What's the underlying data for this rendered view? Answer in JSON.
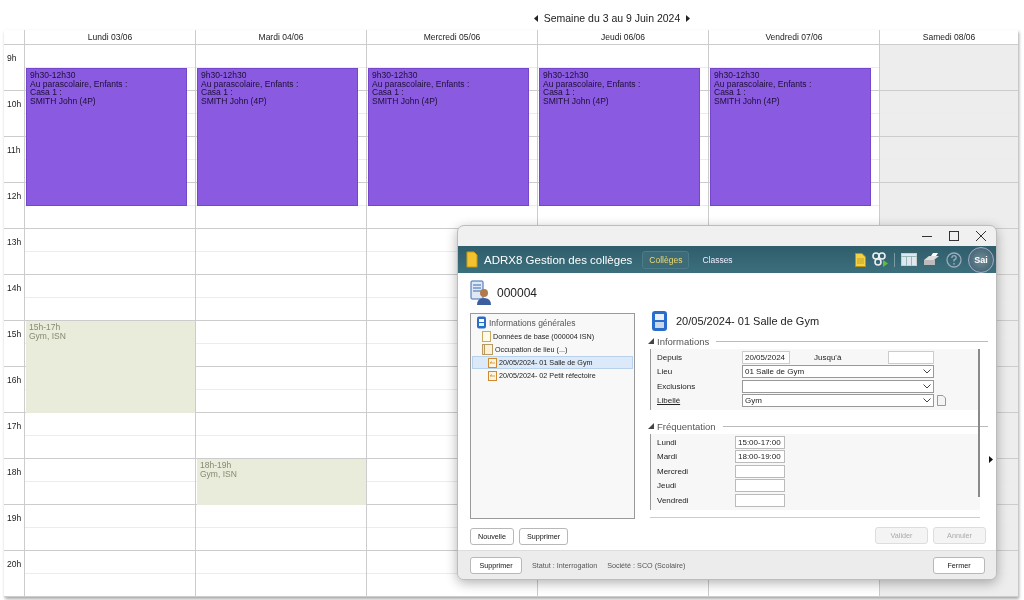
{
  "week_nav": {
    "title": "Semaine du 3 au 9 Juin 2024"
  },
  "calendar": {
    "hours": [
      "9h",
      "10h",
      "11h",
      "12h",
      "13h",
      "14h",
      "15h",
      "16h",
      "17h",
      "18h",
      "19h",
      "20h"
    ],
    "days": [
      {
        "label": "Lundi 03/06",
        "weekend": false,
        "events": [
          {
            "kind": "booking",
            "lines": [
              "9h30-12h30",
              "Au parascolaire, Enfants :",
              "Casa 1 :",
              "SMITH John (4P)"
            ]
          },
          {
            "kind": "occupation",
            "lines": [
              "15h-17h",
              "Gym, ISN"
            ]
          }
        ]
      },
      {
        "label": "Mardi 04/06",
        "weekend": false,
        "events": [
          {
            "kind": "booking",
            "lines": [
              "9h30-12h30",
              "Au parascolaire, Enfants :",
              "Casa 1 :",
              "SMITH John (4P)"
            ]
          },
          {
            "kind": "occupation",
            "lines": [
              "18h-19h",
              "Gym, ISN"
            ]
          }
        ]
      },
      {
        "label": "Mercredi 05/06",
        "weekend": false,
        "events": [
          {
            "kind": "booking",
            "lines": [
              "9h30-12h30",
              "Au parascolaire, Enfants :",
              "Casa 1 :",
              "SMITH John (4P)"
            ]
          }
        ]
      },
      {
        "label": "Jeudi 06/06",
        "weekend": false,
        "events": [
          {
            "kind": "booking",
            "lines": [
              "9h30-12h30",
              "Au parascolaire, Enfants :",
              "Casa 1 :",
              "SMITH John (4P)"
            ]
          }
        ]
      },
      {
        "label": "Vendredi 07/06",
        "weekend": false,
        "events": [
          {
            "kind": "booking",
            "lines": [
              "9h30-12h30",
              "Au parascolaire, Enfants :",
              "Casa 1 :",
              "SMITH John (4P)"
            ]
          }
        ]
      },
      {
        "label": "Samedi 08/06",
        "weekend": true
      }
    ]
  },
  "dialog": {
    "app_title": "ADRX8 Gestion des collèges",
    "tabs": [
      {
        "label": "Collèges",
        "selected": true
      },
      {
        "label": "Classes",
        "selected": false
      }
    ],
    "logo_text": "Sai",
    "record": "000004",
    "tree": [
      {
        "label": "Informations générales",
        "kind": "group",
        "selected": false,
        "children": [
          {
            "label": "Données de base (000004 ISN)",
            "kind": "document",
            "selected": false
          },
          {
            "label": "Occupation de lieu (...)",
            "kind": "folder",
            "selected": false,
            "children": [
              {
                "label": "20/05/2024- 01 Salle de Gym",
                "kind": "entry",
                "selected": true
              },
              {
                "label": "20/05/2024- 02 Petit réfectoire",
                "kind": "entry",
                "selected": false
              }
            ]
          }
        ]
      }
    ],
    "tree_buttons": [
      {
        "label": "Nouvelle",
        "disabled": false
      },
      {
        "label": "Supprimer",
        "disabled": false
      }
    ],
    "detail_title": "20/05/2024- 01 Salle de Gym",
    "informations": {
      "title": "Informations",
      "expanded": true,
      "fields": [
        {
          "kind": "date-range",
          "label": "Depuis",
          "value": "20/05/2024",
          "end_label": "Jusqu'à"
        },
        {
          "kind": "select",
          "label": "Lieu",
          "value": "01 Salle de Gym"
        },
        {
          "kind": "select",
          "label": "Exclusions"
        },
        {
          "kind": "select",
          "label": "Libellé",
          "value": "Gym",
          "link": true,
          "note": true
        }
      ]
    },
    "frequentation": {
      "title": "Fréquentation",
      "expanded": true,
      "rows": [
        {
          "label": "Lundi",
          "value": "15:00-17:00"
        },
        {
          "label": "Mardi",
          "value": "18:00-19:00"
        },
        {
          "label": "Mercredi"
        },
        {
          "label": "Jeudi"
        },
        {
          "label": "Vendredi"
        }
      ]
    },
    "form_buttons": [
      {
        "label": "Valider",
        "disabled": true
      },
      {
        "label": "Annuler",
        "disabled": true
      }
    ],
    "footer": {
      "button": "Supprimer",
      "status": "Statut : Interrogation",
      "company": "Société : SCO (Scolaire)",
      "close": "Fermer"
    }
  }
}
